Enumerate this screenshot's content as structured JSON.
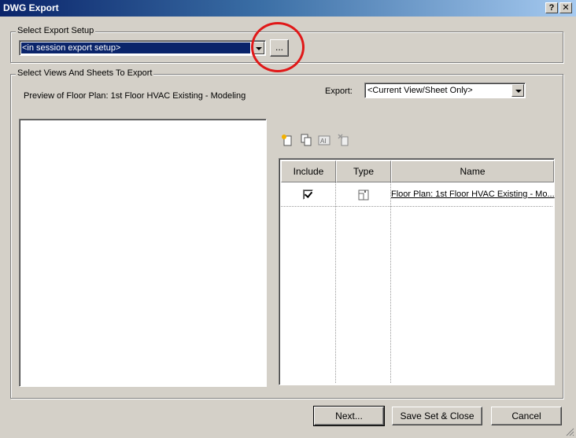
{
  "window": {
    "title": "DWG Export",
    "help_glyph": "?",
    "close_glyph": "✕"
  },
  "setup": {
    "legend": "Select Export Setup",
    "combo_value": "<in session export setup>",
    "browse_label": "..."
  },
  "views": {
    "legend": "Select Views And Sheets To Export",
    "preview_label": "Preview of Floor Plan: 1st Floor HVAC Existing - Modeling",
    "export_label": "Export:",
    "export_value": "<Current View/Sheet Only>"
  },
  "toolbar_icons": [
    "new-set-icon",
    "duplicate-set-icon",
    "rename-set-icon",
    "delete-set-icon"
  ],
  "table": {
    "columns": [
      "Include",
      "Type",
      "Name"
    ],
    "rows": [
      {
        "include": true,
        "type_icon": "floor-plan-icon",
        "name": "Floor Plan: 1st Floor HVAC Existing - Mo..."
      }
    ]
  },
  "footer": {
    "next_label": "Next...",
    "save_label": "Save Set & Close",
    "cancel_label": "Cancel"
  },
  "colors": {
    "title_gradient_start": "#0a246a",
    "title_gradient_end": "#a6caf0",
    "dialog_bg": "#d4d0c8",
    "selection": "#0a246a",
    "highlight_circle": "#e01818"
  }
}
